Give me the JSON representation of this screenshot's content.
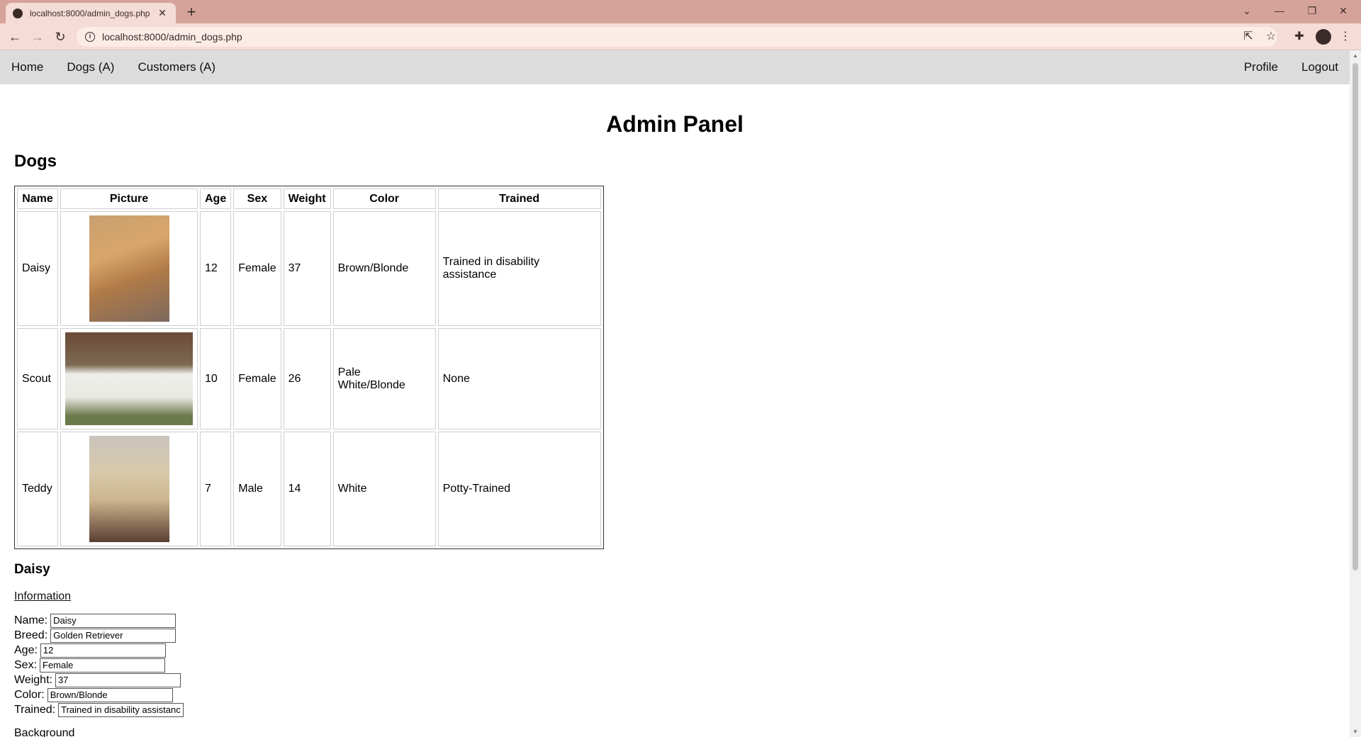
{
  "browser": {
    "tab_title": "localhost:8000/admin_dogs.php",
    "url": "localhost:8000/admin_dogs.php"
  },
  "nav": {
    "left": [
      "Home",
      "Dogs (A)",
      "Customers (A)"
    ],
    "right": [
      "Profile",
      "Logout"
    ]
  },
  "page": {
    "title": "Admin Panel",
    "section_title": "Dogs"
  },
  "table": {
    "headers": [
      "Name",
      "Picture",
      "Age",
      "Sex",
      "Weight",
      "Color",
      "Trained"
    ],
    "rows": [
      {
        "name": "Daisy",
        "age": "12",
        "sex": "Female",
        "weight": "37",
        "color": "Brown/Blonde",
        "trained": "Trained in disability assistance"
      },
      {
        "name": "Scout",
        "age": "10",
        "sex": "Female",
        "weight": "26",
        "color": "Pale White/Blonde",
        "trained": "None"
      },
      {
        "name": "Teddy",
        "age": "7",
        "sex": "Male",
        "weight": "14",
        "color": "White",
        "trained": "Potty-Trained"
      }
    ]
  },
  "detail": {
    "title": "Daisy",
    "info_link": "Information",
    "fields": {
      "name_label": "Name:",
      "name_value": "Daisy",
      "breed_label": "Breed:",
      "breed_value": "Golden Retriever",
      "age_label": "Age:",
      "age_value": "12",
      "sex_label": "Sex:",
      "sex_value": "Female",
      "weight_label": "Weight:",
      "weight_value": "37",
      "color_label": "Color:",
      "color_value": "Brown/Blonde",
      "trained_label": "Trained:",
      "trained_value": "Trained in disability assistance"
    },
    "background_label": "Background"
  }
}
